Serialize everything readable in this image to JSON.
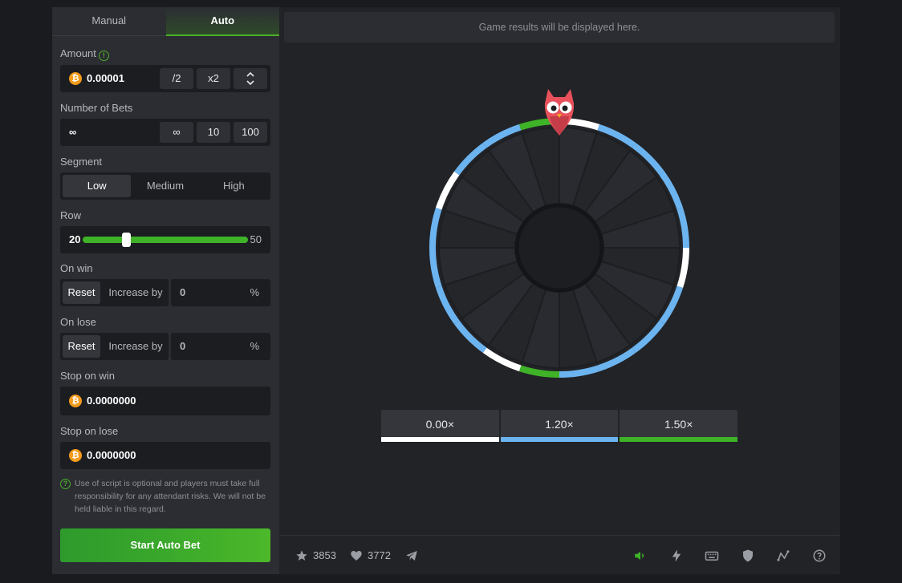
{
  "tabs": {
    "manual": "Manual",
    "auto": "Auto"
  },
  "amount": {
    "label": "Amount",
    "value": "0.00001",
    "half": "/2",
    "double": "x2",
    "currency_icon": "bitcoin-icon"
  },
  "bets": {
    "label": "Number of Bets",
    "value": "∞",
    "opt_inf": "∞",
    "opt_10": "10",
    "opt_100": "100"
  },
  "segment": {
    "label": "Segment",
    "low": "Low",
    "medium": "Medium",
    "high": "High",
    "selected": "Low"
  },
  "row": {
    "label": "Row",
    "min": "20",
    "max": "50",
    "value_fraction": 0.26
  },
  "on_win": {
    "label": "On win",
    "reset": "Reset",
    "increase": "Increase by",
    "value": "0",
    "unit": "%"
  },
  "on_lose": {
    "label": "On lose",
    "reset": "Reset",
    "increase": "Increase by",
    "value": "0",
    "unit": "%"
  },
  "stop_win": {
    "label": "Stop on win",
    "value": "0.0000000"
  },
  "stop_lose": {
    "label": "Stop on lose",
    "value": "0.0000000"
  },
  "disclaimer": "Use of script is optional and players must take full responsibility for any attendant risks. We will not be held liable in this regard.",
  "start_button": "Start Auto Bet",
  "results_text": "Game results will be displayed here.",
  "multipliers": [
    {
      "label": "0.00×",
      "color": "#ffffff"
    },
    {
      "label": "1.20×",
      "color": "#6cb4f0"
    },
    {
      "label": "1.50×",
      "color": "#3fb328"
    }
  ],
  "footer": {
    "favorites": "3853",
    "likes": "3772"
  },
  "colors": {
    "accent": "#3fb328",
    "blue": "#6cb4f0",
    "white": "#ffffff",
    "panel": "#2b2d32"
  }
}
